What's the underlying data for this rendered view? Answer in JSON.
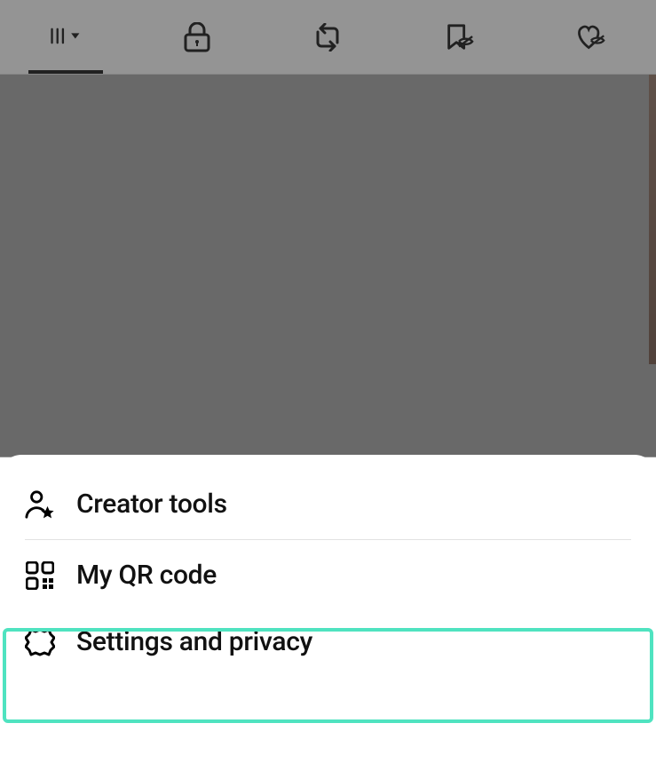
{
  "tabs": {
    "active_index": 0,
    "items": [
      {
        "name": "grid-tab"
      },
      {
        "name": "private-tab"
      },
      {
        "name": "reposts-tab"
      },
      {
        "name": "saved-tab"
      },
      {
        "name": "liked-tab"
      }
    ]
  },
  "menu": {
    "items": [
      {
        "label": "Creator tools"
      },
      {
        "label": "My QR code"
      },
      {
        "label": "Settings and privacy"
      }
    ]
  },
  "highlight": {
    "color": "#4fe3c0"
  }
}
